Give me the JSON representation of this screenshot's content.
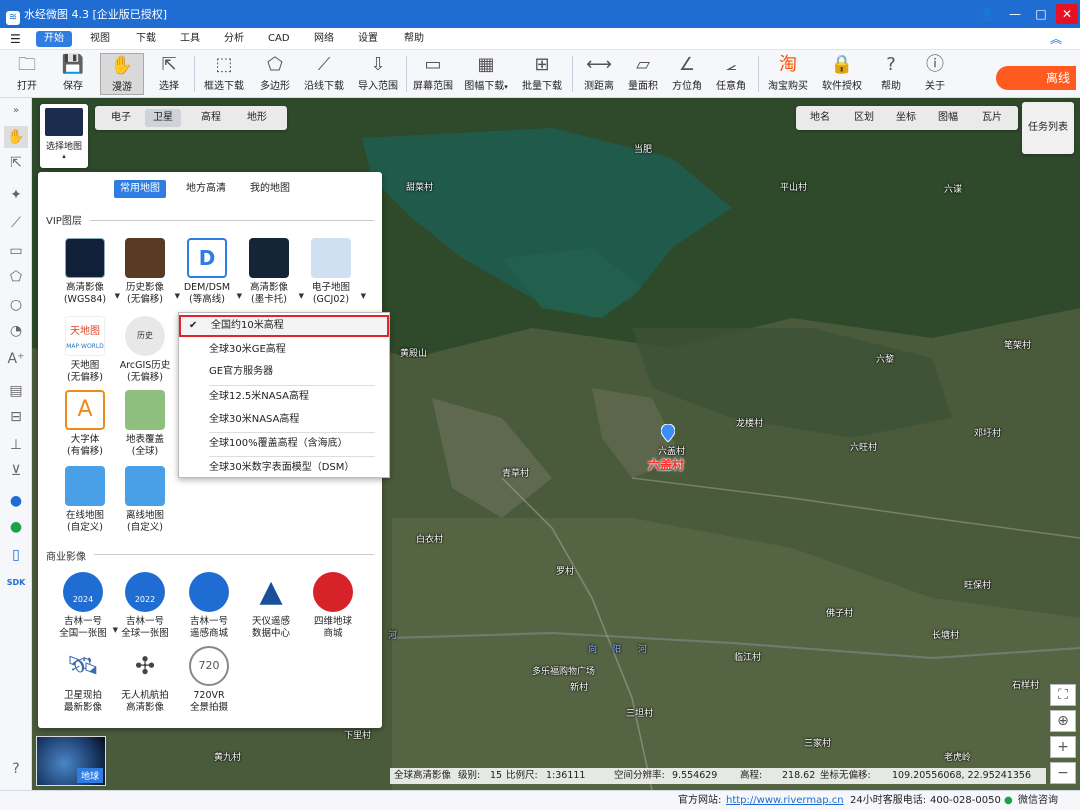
{
  "app": {
    "title": "水经微图 4.3 [企业版已授权]"
  },
  "menu": [
    "开始",
    "视图",
    "下载",
    "工具",
    "分析",
    "CAD",
    "网络",
    "设置",
    "帮助"
  ],
  "toolbar": {
    "items": [
      "打开",
      "保存",
      "漫游",
      "选择",
      "框选下载",
      "多边形",
      "沿线下载",
      "导入范围",
      "屏幕范围",
      "图幅下载",
      "批量下载",
      "测距离",
      "量面积",
      "方位角",
      "任意角",
      "淘宝购买",
      "软件授权",
      "帮助",
      "关于"
    ],
    "promo": "离线"
  },
  "map": {
    "type_tabs": [
      "电子",
      "卫星",
      "高程",
      "地形"
    ],
    "tool_tabs": [
      "地名",
      "区划",
      "坐标",
      "图幅",
      "瓦片"
    ],
    "task_list": "任务列表",
    "select_map": "选择地图",
    "places": [
      "当肥",
      "甜菜村",
      "平山村",
      "六谍",
      "黄殿山",
      "笔架村",
      "六黎",
      "龙楼村",
      "六旺村",
      "邓圩村",
      "六盖村",
      "青草村",
      "白衣村",
      "罗村",
      "旺保村",
      "佛子村",
      "长塘村",
      "临江村",
      "多乐福购物广场",
      "新村",
      "石样村",
      "三坦村",
      "三家村",
      "黄九村",
      "下里村",
      "老虎岭",
      "向",
      "阳",
      "河",
      "河"
    ],
    "marker_label": "六盖村",
    "globe_label": "地球"
  },
  "panel": {
    "tabs": [
      "常用地图",
      "地方高清",
      "我的地图"
    ],
    "vip_label": "VIP图层",
    "vip_layers": [
      [
        "高清影像",
        "(WGS84)"
      ],
      [
        "历史影像",
        "(无偏移)"
      ],
      [
        "DEM/DSM",
        "(等高线)"
      ],
      [
        "高清影像",
        "(墨卡托)"
      ],
      [
        "电子地图",
        "(GCJ02)"
      ],
      [
        "天地图",
        "(无偏移)"
      ],
      [
        "ArcGIS历史",
        "(无偏移)"
      ],
      [
        "大字体",
        "(有偏移)"
      ],
      [
        "地表覆盖",
        "(全球)"
      ],
      [
        "在线地图",
        "(自定义)"
      ],
      [
        "离线地图",
        "(自定义)"
      ]
    ],
    "biz_label": "商业影像",
    "biz_layers": [
      [
        "吉林一号",
        "全国一张图"
      ],
      [
        "吉林一号",
        "全球一张图"
      ],
      [
        "吉林一号",
        "遥感商城"
      ],
      [
        "天仪遥感",
        "数据中心"
      ],
      [
        "四维地球",
        "商城"
      ],
      [
        "卫星现拍",
        "最新影像"
      ],
      [
        "无人机航拍",
        "高清影像"
      ],
      [
        "720VR",
        "全景拍摄"
      ]
    ],
    "thumb_texts": {
      "history": "历史",
      "tianditu": "天地图",
      "tianditu_sub": "MAP WORLD",
      "bigfont": "A",
      "biz_year1": "2024",
      "biz_year2": "2022",
      "vr": "720"
    }
  },
  "dropdown": {
    "items": [
      "全国约10米高程",
      "全球30米GE高程",
      "GE官方服务器",
      "全球12.5米NASA高程",
      "全球30米NASA高程",
      "全球100%覆盖高程（含海底）",
      "全球30米数字表面模型（DSM）"
    ],
    "checked_index": 0
  },
  "status": {
    "layer": "全球高清影像",
    "level_label": "级别:",
    "level": "15",
    "scale_label": "比例尺:",
    "scale": "1:36111",
    "resolution_label": "空间分辨率:",
    "resolution": "9.554629",
    "elev_label": "高程:",
    "elev": "218.62",
    "coord_label": "坐标无偏移:",
    "coord": "109.20556068, 22.95241356"
  },
  "footer": {
    "site_label": "官方网站:",
    "site": "http://www.rivermap.cn",
    "phone_label": "24小时客服电话:",
    "phone": "400-028-0050",
    "wechat": "微信咨询"
  },
  "colors": {
    "accent": "#2f7de1",
    "title": "#1f6dd3",
    "highlight": "#e0262c"
  }
}
